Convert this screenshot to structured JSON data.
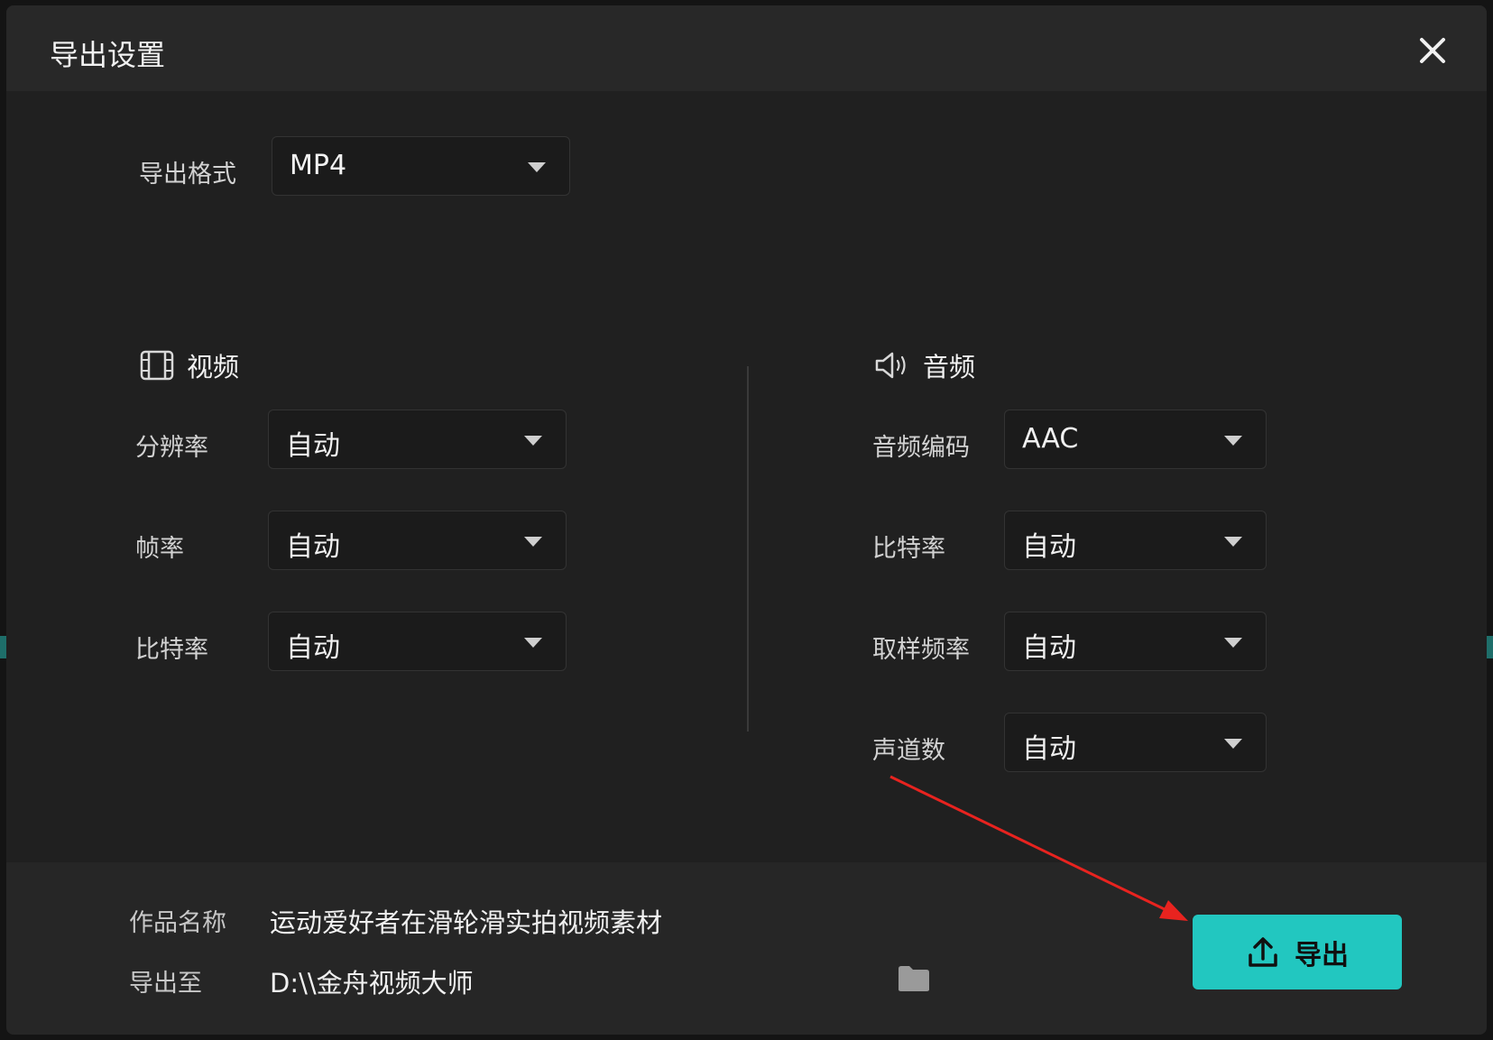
{
  "dialog": {
    "title": "导出设置"
  },
  "format": {
    "label": "导出格式",
    "value": "MP4"
  },
  "video": {
    "heading": "视频",
    "fields": [
      {
        "label": "分辨率",
        "value": "自动"
      },
      {
        "label": "帧率",
        "value": "自动"
      },
      {
        "label": "比特率",
        "value": "自动"
      }
    ]
  },
  "audio": {
    "heading": "音频",
    "fields": [
      {
        "label": "音频编码",
        "value": "AAC"
      },
      {
        "label": "比特率",
        "value": "自动"
      },
      {
        "label": "取样频率",
        "value": "自动"
      },
      {
        "label": "声道数",
        "value": "自动"
      }
    ]
  },
  "footer": {
    "name_label": "作品名称",
    "name_value": "运动爱好者在滑轮滑实拍视频素材",
    "path_label": "导出至",
    "path_value": "D:\\\\金舟视频大师",
    "export_label": "导出"
  },
  "colors": {
    "accent": "#22c7c0",
    "annotation_arrow": "#e8231f"
  }
}
